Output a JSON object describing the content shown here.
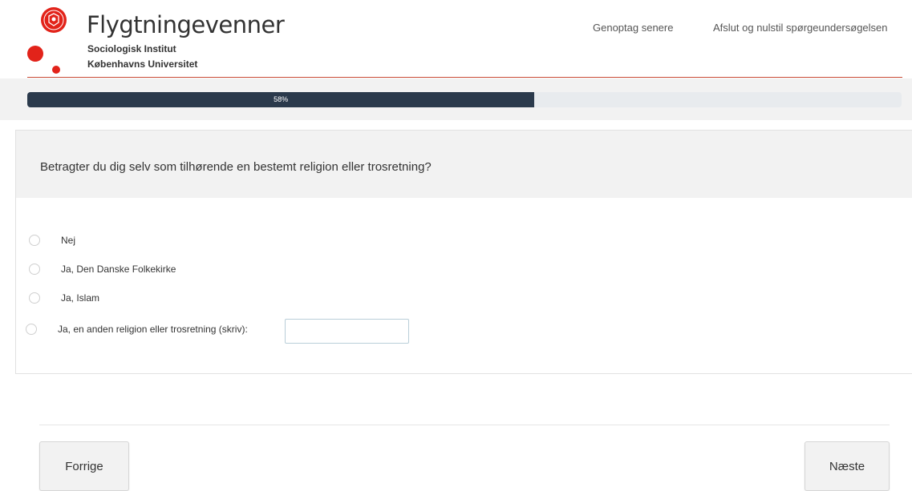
{
  "colors": {
    "accent": "#c84b36",
    "logo_red": "#e2231a",
    "progress_fill": "#2b3a4c"
  },
  "header": {
    "title": "Flygtningevenner",
    "subtitle1": "Sociologisk Institut",
    "subtitle2": "Københavns Universitet",
    "resume_link": "Genoptag senere",
    "quit_link": "Afslut og nulstil spørgeundersøgelsen"
  },
  "progress": {
    "value": 58,
    "label": "58%"
  },
  "question": {
    "text": "Betragter du dig selv som tilhørende en bestemt religion eller trosretning?",
    "options": [
      {
        "label": "Nej",
        "selected": false
      },
      {
        "label": "Ja, Den Danske Folkekirke",
        "selected": false
      },
      {
        "label": "Ja, Islam",
        "selected": false
      },
      {
        "label": "Ja, en anden religion eller trosretning (skriv):",
        "selected": false
      }
    ],
    "other_value": ""
  },
  "nav": {
    "prev_label": "Forrige",
    "next_label": "Næste"
  }
}
